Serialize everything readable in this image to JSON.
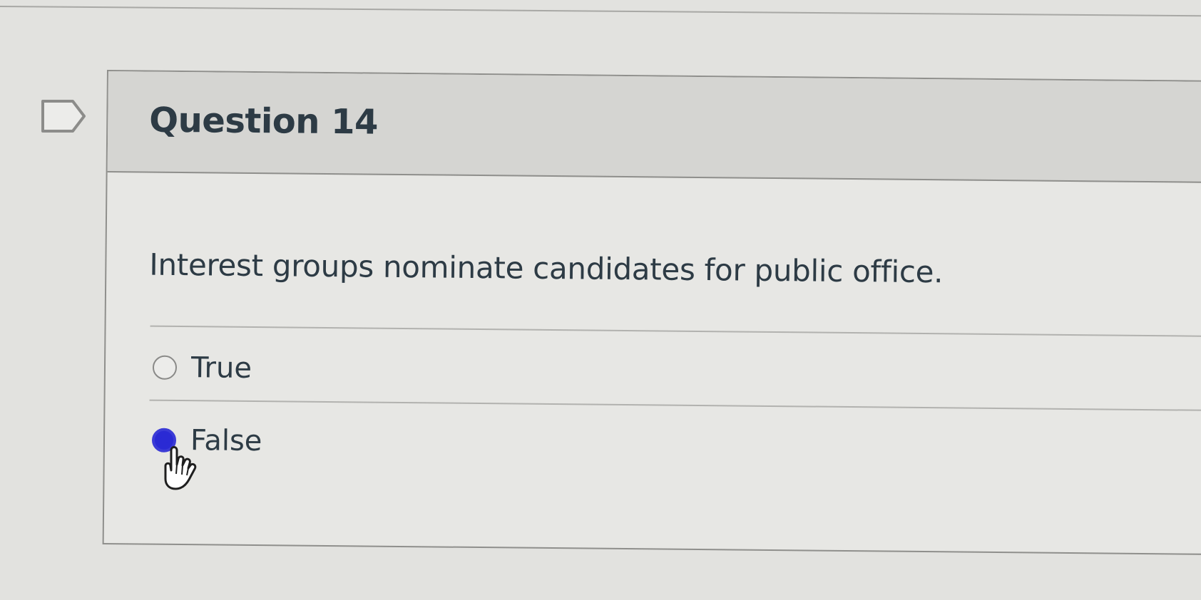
{
  "quiz": {
    "question_title": "Question 14",
    "question_text": "Interest groups nominate candidates for public office.",
    "answers": [
      {
        "label": "True",
        "selected": false
      },
      {
        "label": "False",
        "selected": true
      }
    ]
  },
  "icons": {
    "flag": "flag-icon",
    "cursor": "hand-pointer-icon"
  },
  "colors": {
    "selected_radio": "#2a2ad4",
    "text": "#2d3b45"
  }
}
